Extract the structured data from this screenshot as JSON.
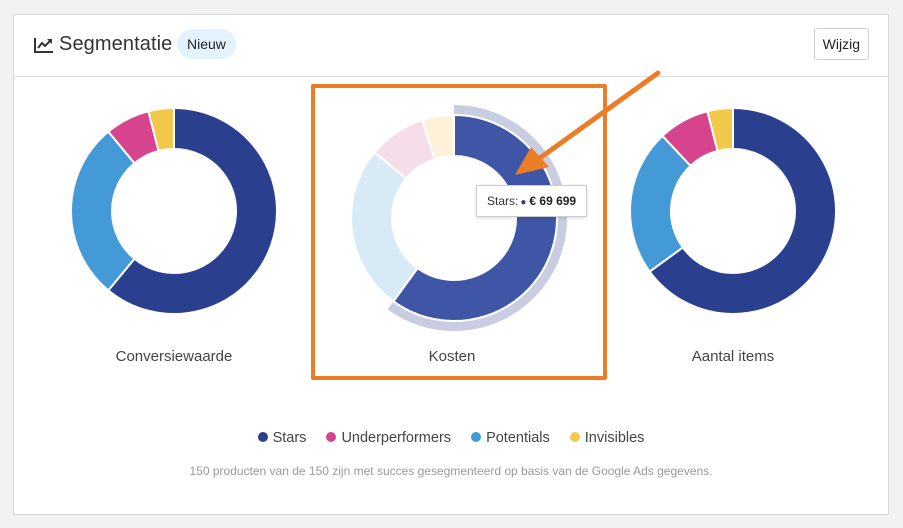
{
  "header": {
    "icon": "trend-chart-icon",
    "title": "Segmentatie",
    "badge": "Nieuw",
    "edit_button": "Wijzig"
  },
  "colors": {
    "stars": "#2b3f8f",
    "underperformers": "#d6448e",
    "potentials": "#449ad6",
    "invisibles": "#f2c84b",
    "highlight": "#ea7d26"
  },
  "chart_data": [
    {
      "type": "pie",
      "title": "Conversiewaarde",
      "series": [
        {
          "name": "Stars",
          "value": 61
        },
        {
          "name": "Potentials",
          "value": 28
        },
        {
          "name": "Underperformers",
          "value": 7
        },
        {
          "name": "Invisibles",
          "value": 4
        }
      ]
    },
    {
      "type": "pie",
      "title": "Kosten",
      "series": [
        {
          "name": "Stars",
          "value": 60
        },
        {
          "name": "Potentials",
          "value": 26
        },
        {
          "name": "Underperformers",
          "value": 9
        },
        {
          "name": "Invisibles",
          "value": 5
        }
      ],
      "highlighted": "Stars"
    },
    {
      "type": "pie",
      "title": "Aantal items",
      "series": [
        {
          "name": "Stars",
          "value": 65
        },
        {
          "name": "Potentials",
          "value": 23
        },
        {
          "name": "Underperformers",
          "value": 8
        },
        {
          "name": "Invisibles",
          "value": 4
        }
      ]
    }
  ],
  "tooltip": {
    "label": "Stars:",
    "value": "€ 69 699"
  },
  "legend": [
    {
      "label": "Stars",
      "color": "#2b3f8f"
    },
    {
      "label": "Underperformers",
      "color": "#d6448e"
    },
    {
      "label": "Potentials",
      "color": "#449ad6"
    },
    {
      "label": "Invisibles",
      "color": "#f2c84b"
    }
  ],
  "footnote": "150 producten van de 150 zijn met succes gesegmenteerd op basis van de Google Ads gegevens."
}
